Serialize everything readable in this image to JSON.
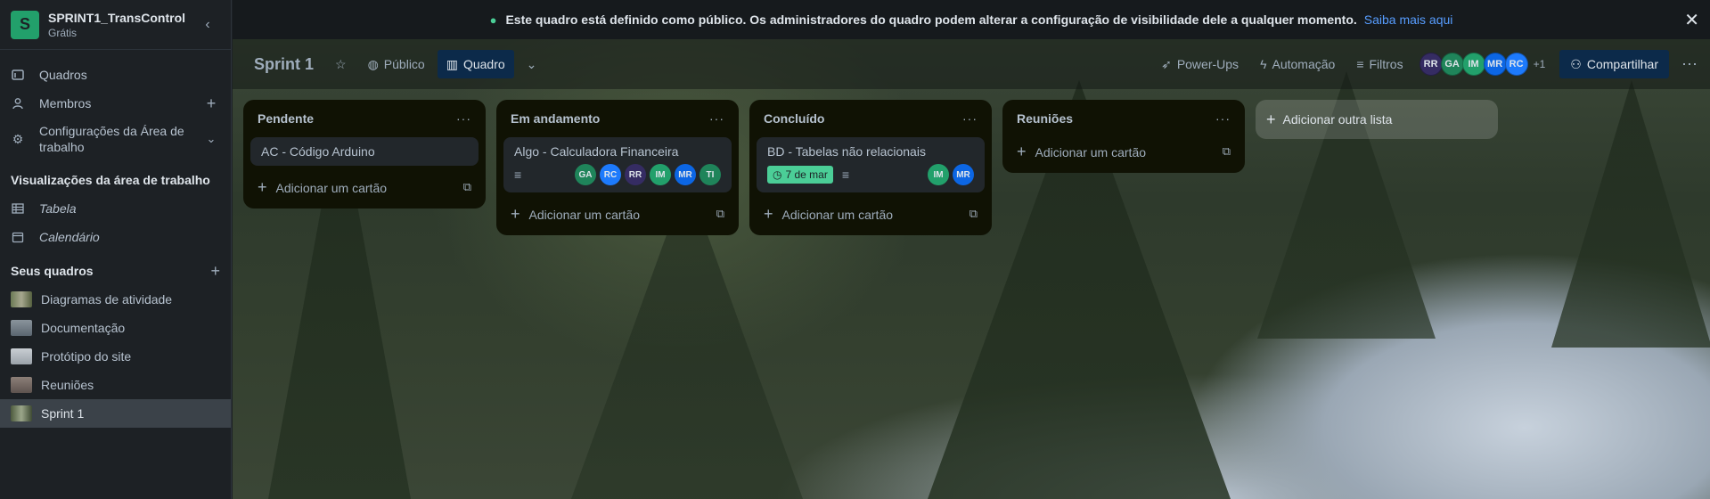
{
  "workspace": {
    "initial": "S",
    "name": "SPRINT1_TransControl",
    "plan": "Grátis"
  },
  "sidebar": {
    "items": [
      {
        "label": "Quadros",
        "icon": "boards-icon"
      },
      {
        "label": "Membros",
        "icon": "person-icon"
      },
      {
        "label": "Configurações da Área de trabalho",
        "icon": "gear-icon"
      }
    ],
    "views_title": "Visualizações da área de trabalho",
    "views": [
      {
        "label": "Tabela"
      },
      {
        "label": "Calendário"
      }
    ],
    "boards_title": "Seus quadros",
    "boards": [
      {
        "label": "Diagramas de atividade"
      },
      {
        "label": "Documentação"
      },
      {
        "label": "Protótipo do site"
      },
      {
        "label": "Reuniões"
      },
      {
        "label": "Sprint 1"
      }
    ]
  },
  "notice": {
    "text": "Este quadro está definido como público. Os administradores do quadro podem alterar a configuração de visibilidade dele a qualquer momento.",
    "link": "Saiba mais aqui"
  },
  "board": {
    "title": "Sprint 1",
    "visibility": "Público",
    "view": "Quadro",
    "powerups": "Power-Ups",
    "automation": "Automação",
    "filters": "Filtros",
    "members": [
      "RR",
      "GA",
      "IM",
      "MR",
      "RC"
    ],
    "more_members": "+1",
    "share": "Compartilhar"
  },
  "lists": [
    {
      "title": "Pendente",
      "cards": [
        {
          "title": "AC - Código Arduino"
        }
      ],
      "add_card": "Adicionar um cartão"
    },
    {
      "title": "Em andamento",
      "cards": [
        {
          "title": "Algo - Calculadora Financeira",
          "members": [
            "GA",
            "RC",
            "RR",
            "IM",
            "MR",
            "TI"
          ]
        }
      ],
      "add_card": "Adicionar um cartão"
    },
    {
      "title": "Concluído",
      "cards": [
        {
          "title": "BD - Tabelas não relacionais",
          "due": "7 de mar",
          "members": [
            "IM",
            "MR"
          ]
        }
      ],
      "add_card": "Adicionar um cartão"
    },
    {
      "title": "Reuniões",
      "cards": [],
      "add_card": "Adicionar um cartão"
    }
  ],
  "add_list": "Adicionar outra lista",
  "colors": {
    "accent": "#579dff",
    "brand": "#22a06b",
    "due_badge": "#4bce97"
  }
}
